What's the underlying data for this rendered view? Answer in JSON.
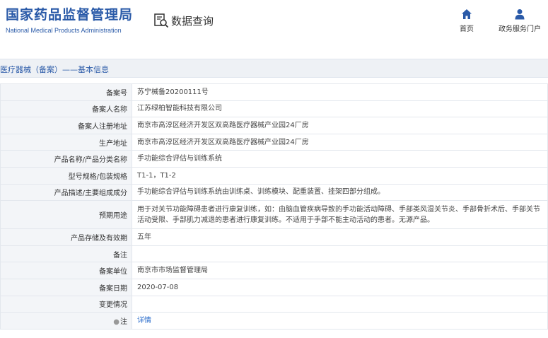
{
  "header": {
    "logo_cn": "国家药品监督管理局",
    "logo_en": "National Medical Products Administration",
    "query_label": "数据查询",
    "nav": [
      {
        "label": "首页",
        "icon": "home-icon"
      },
      {
        "label": "政务服务门户",
        "icon": "user-icon"
      }
    ]
  },
  "section": {
    "title": "医疗器械（备案）——基本信息"
  },
  "rows": [
    {
      "label": "备案号",
      "value": "苏宁械备20200111号"
    },
    {
      "label": "备案人名称",
      "value": "江苏绿柏智能科技有限公司"
    },
    {
      "label": "备案人注册地址",
      "value": "南京市高淳区经济开发区双高路医疗器械产业园24厂房"
    },
    {
      "label": "生产地址",
      "value": "南京市高淳区经济开发区双高路医疗器械产业园24厂房"
    },
    {
      "label": "产品名称/产品分类名称",
      "value": "手功能综合评估与训练系统"
    },
    {
      "label": "型号规格/包装规格",
      "value": "T1-1，T1-2"
    },
    {
      "label": "产品描述/主要组成成分",
      "value": "手功能综合评估与训练系统由训练桌、训练模块、配重装置、挂架四部分组成。"
    },
    {
      "label": "预期用途",
      "value": "用于对关节功能障碍患者进行康复训练，如：由脑血管疾病导致的手功能活动障碍、手部类风湿关节炎、手部骨折术后、手部关节活动受限、手部肌力减退的患者进行康复训练。不适用于手部不能主动活动的患者。无源产品。"
    },
    {
      "label": "产品存储及有效期",
      "value": "五年"
    },
    {
      "label": "备注",
      "value": ""
    },
    {
      "label": "备案单位",
      "value": "南京市市场监督管理局"
    },
    {
      "label": "备案日期",
      "value": "2020-07-08"
    },
    {
      "label": "变更情况",
      "value": ""
    },
    {
      "label": "注",
      "value": "详情"
    }
  ],
  "colors": {
    "brand": "#2a5aa8",
    "link": "#2a6ccb",
    "label_bg": "#f3f5f8",
    "section_bg": "#eef1f5"
  }
}
